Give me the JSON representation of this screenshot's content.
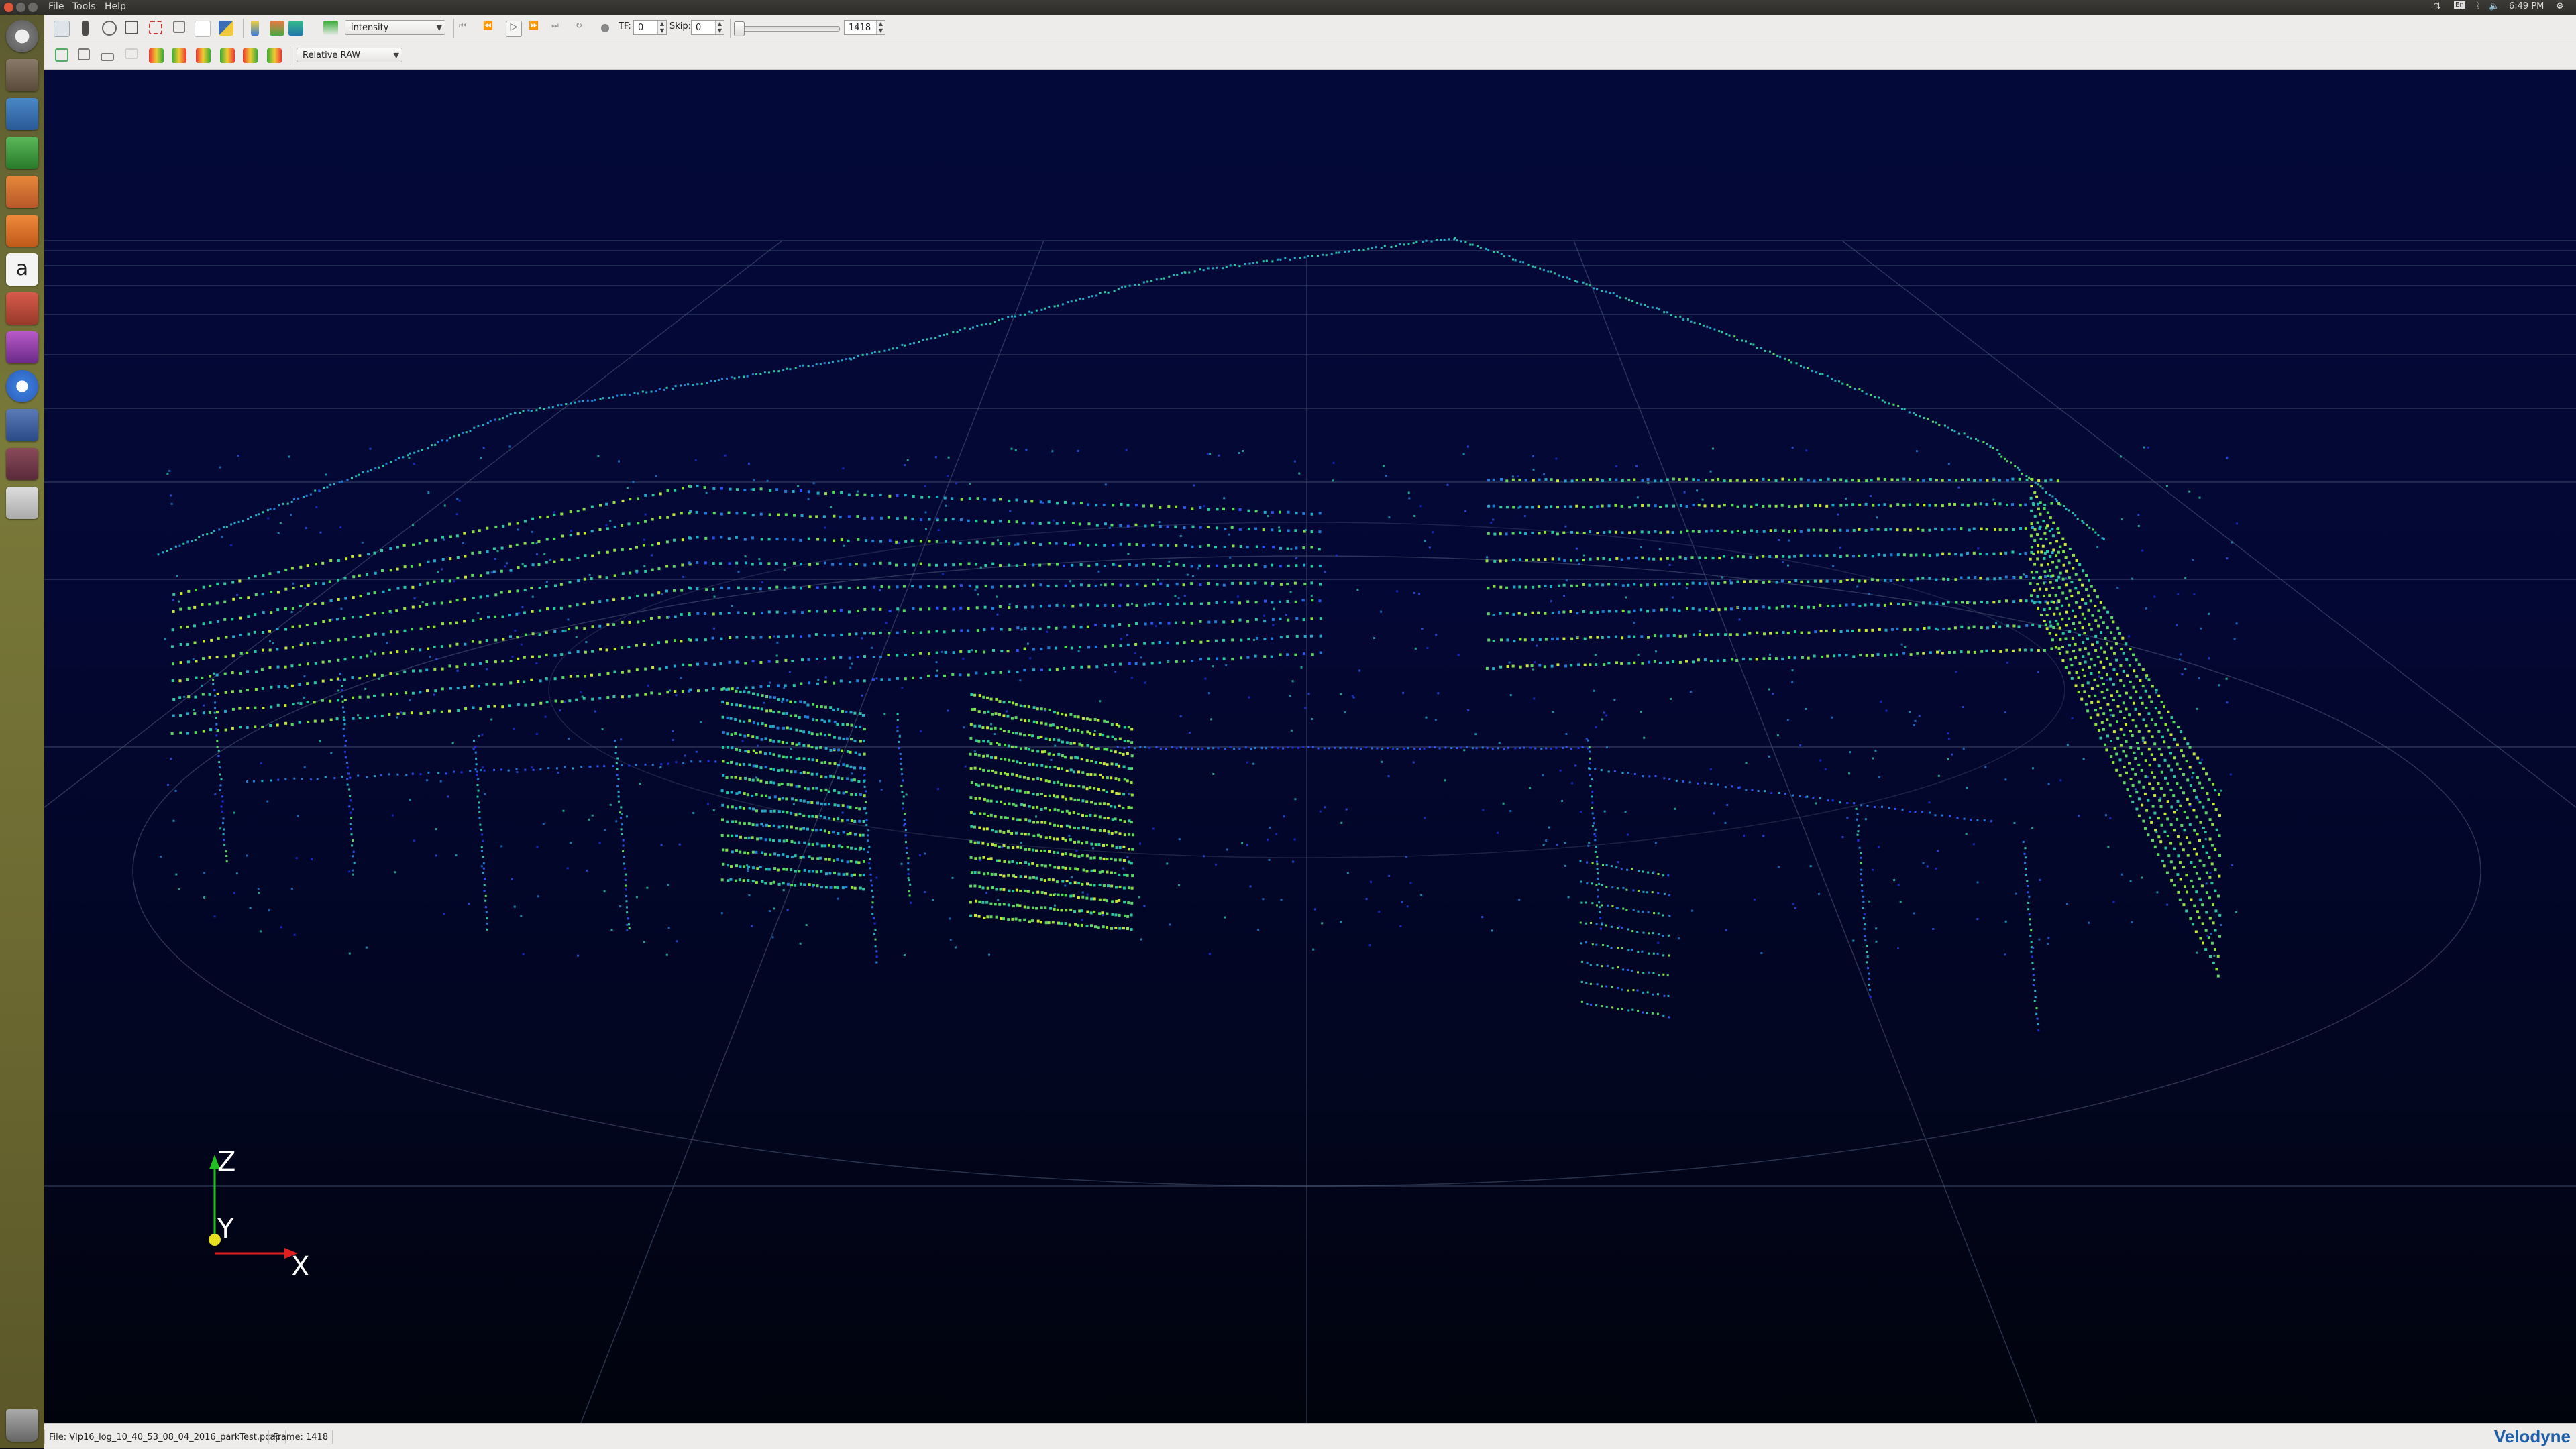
{
  "menubar": {
    "items": [
      "File",
      "Tools",
      "Help"
    ],
    "clock": "6:49 PM",
    "tray_keyboard": "En"
  },
  "toolbar1": {
    "color_by": "intensity",
    "tf_label": "TF:",
    "tf_value": "0",
    "skip_label": "Skip:",
    "skip_value": "0",
    "frame_value": "1418"
  },
  "toolbar2": {
    "mode": "Relative RAW"
  },
  "viewport": {
    "axis_labels": {
      "z": "Z",
      "y": "Y",
      "x": "X"
    },
    "colors": {
      "background": "#030938",
      "grid": "#5a6a7a",
      "axis_x": "#e02020",
      "axis_z": "#20c020",
      "axis_y": "#e8e020"
    }
  },
  "launcher": {
    "icons": [
      "dash-icon",
      "files-icon",
      "writer-icon",
      "calc-icon",
      "impress-icon",
      "software-center-icon",
      "amazon-icon",
      "system-settings-icon",
      "media-icon",
      "chromium-icon",
      "app-icon",
      "app-icon-2",
      "disk-icon",
      "trash-icon"
    ]
  },
  "statusbar": {
    "file": "File: Vlp16_log_10_40_53_08_04_2016_parkTest.pcap",
    "frame": "Frame: 1418",
    "brand": "Velodyne"
  }
}
